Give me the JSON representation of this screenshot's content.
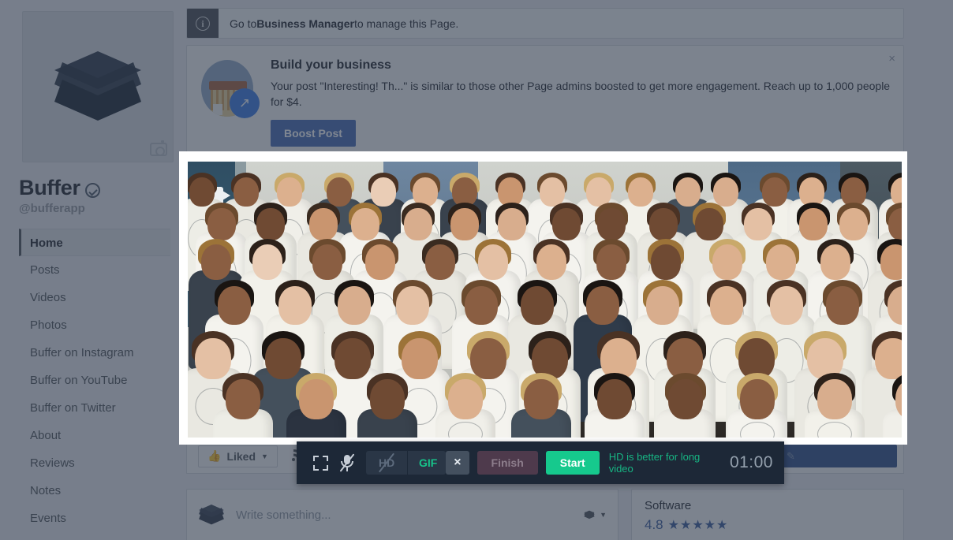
{
  "profile": {
    "name": "Buffer",
    "handle": "@bufferapp",
    "verified_icon": "verified-badge-icon",
    "avatar_icon": "buffer-layers-logo",
    "avatar_camera_icon": "camera-icon"
  },
  "sidebar": {
    "items": [
      {
        "label": "Home",
        "active": true
      },
      {
        "label": "Posts",
        "active": false
      },
      {
        "label": "Videos",
        "active": false
      },
      {
        "label": "Photos",
        "active": false
      },
      {
        "label": "Buffer on Instagram",
        "active": false
      },
      {
        "label": "Buffer on YouTube",
        "active": false
      },
      {
        "label": "Buffer on Twitter",
        "active": false
      },
      {
        "label": "About",
        "active": false
      },
      {
        "label": "Reviews",
        "active": false
      },
      {
        "label": "Notes",
        "active": false
      },
      {
        "label": "Events",
        "active": false
      }
    ]
  },
  "info_bar": {
    "icon": "info-icon",
    "icon_glyph": "i",
    "text_before": "Go to ",
    "link_text": "Business Manager",
    "text_after": " to manage this Page."
  },
  "build_card": {
    "title": "Build your business",
    "description": "Your post \"Interesting! Th...\" is similar to those other Page admins boosted to get more engagement. Reach up to 1,000 people for $4.",
    "button_label": "Boost Post",
    "close_label": "×",
    "illustration_icon": "storefront-icon",
    "badge_icon": "trending-up-arrow-icon"
  },
  "action_row": {
    "liked_label": "Liked",
    "liked_icon": "thumbs-up-icon",
    "liked_caret": "▼",
    "rss_icon": "rss-icon",
    "rss_glyph": "◔",
    "primary_button_icon": "pencil-icon"
  },
  "composer": {
    "placeholder": "Write something...",
    "logo_icon": "buffer-layers-logo",
    "audience_icon": "audience-stack-icon",
    "audience_caret": "▼"
  },
  "software_card": {
    "title": "Software",
    "score": "4.8",
    "stars": "★★★★★",
    "star_count": 5
  },
  "selection": {
    "video_badge_icon": "video-camera-icon",
    "corner_handles": 4
  },
  "rec_toolbar": {
    "crop_icon": "crop-selection-icon",
    "mic_icon": "microphone-muted-icon",
    "hd_label": "HD",
    "hd_icon": "hd-disabled-icon",
    "gif_label": "GIF",
    "close_label": "×",
    "close_icon": "close-icon",
    "finish_label": "Finish",
    "start_label": "Start",
    "hint": "HD is better for long video",
    "timer": "01:00"
  },
  "colors": {
    "accent_green": "#16c98d",
    "facebook_blue": "#4267b2",
    "toolbar_bg": "#1d2837",
    "dim_overlay": "#5a6472",
    "rating_blue": "#365899"
  }
}
